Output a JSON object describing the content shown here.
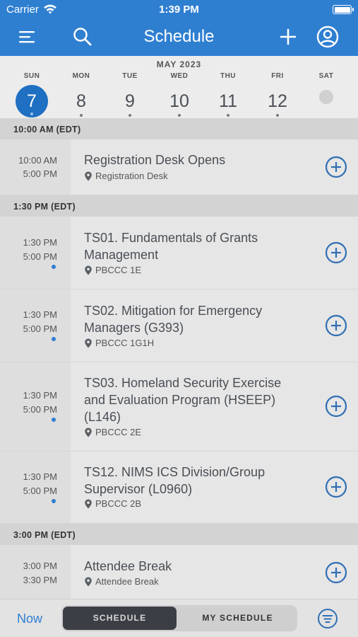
{
  "status_bar": {
    "carrier": "Carrier",
    "time": "1:39 PM"
  },
  "nav": {
    "title": "Schedule",
    "icons": [
      "menu-icon",
      "search-icon",
      "plus-icon",
      "profile-icon"
    ]
  },
  "week": {
    "month": "MAY 2023",
    "days": [
      {
        "dow": "SUN",
        "num": "7",
        "selected": true
      },
      {
        "dow": "MON",
        "num": "8"
      },
      {
        "dow": "TUE",
        "num": "9"
      },
      {
        "dow": "WED",
        "num": "10"
      },
      {
        "dow": "THU",
        "num": "11"
      },
      {
        "dow": "FRI",
        "num": "12"
      },
      {
        "dow": "SAT",
        "num": ""
      }
    ]
  },
  "sections": [
    {
      "header": "10:00 AM (EDT)",
      "events": [
        {
          "start": "10:00 AM",
          "end": "5:00 PM",
          "title_lines": [
            "Registration Desk Opens"
          ],
          "location": "Registration Desk",
          "in_my_schedule": false
        }
      ]
    },
    {
      "header": "1:30 PM (EDT)",
      "events": [
        {
          "start": "1:30 PM",
          "end": "5:00 PM",
          "title_lines": [
            "TS01. Fundamentals of Grants",
            "Management"
          ],
          "location": "PBCCC 1E",
          "in_my_schedule": true
        },
        {
          "start": "1:30 PM",
          "end": "5:00 PM",
          "title_lines": [
            "TS02. Mitigation for Emergency",
            "Managers (G393)"
          ],
          "location": "PBCCC 1G1H",
          "in_my_schedule": true
        },
        {
          "start": "1:30 PM",
          "end": "5:00 PM",
          "title_lines": [
            "TS03. Homeland Security Exercise",
            "and Evaluation Program (HSEEP)",
            "(L146)"
          ],
          "location": "PBCCC 2E",
          "in_my_schedule": true
        },
        {
          "start": "1:30 PM",
          "end": "5:00 PM",
          "title_lines": [
            "TS12. NIMS ICS Division/Group",
            "Supervisor (L0960)"
          ],
          "location": "PBCCC 2B",
          "in_my_schedule": true
        }
      ]
    },
    {
      "header": "3:00 PM (EDT)",
      "events": [
        {
          "start": "3:00 PM",
          "end": "3:30 PM",
          "title_lines": [
            "Attendee Break"
          ],
          "location": "Attendee Break",
          "in_my_schedule": false
        }
      ]
    }
  ],
  "bottom_bar": {
    "now_label": "Now",
    "tabs": [
      "SCHEDULE",
      "MY SCHEDULE"
    ],
    "active_tab": "SCHEDULE",
    "filter_icon": "filter-icon"
  },
  "colors": {
    "nav_blue": "#2f7fd1",
    "selected_day": "#1f6fc2",
    "background": "#e6e6e6",
    "section_header": "#d3d3d3"
  }
}
